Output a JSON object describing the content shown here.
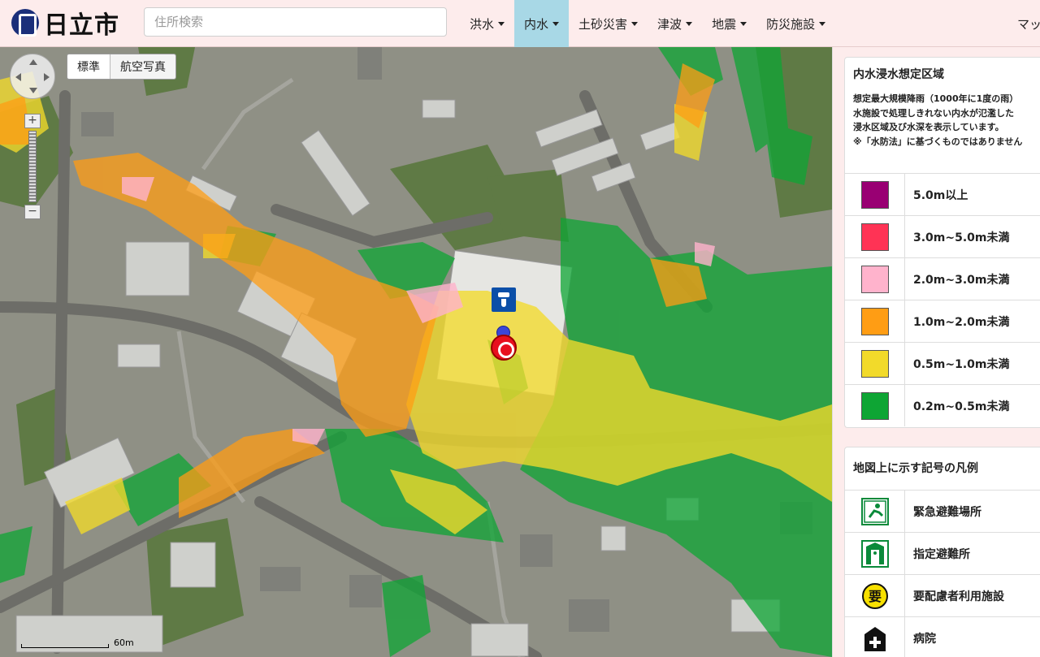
{
  "header": {
    "logo_text": "日立市",
    "search_placeholder": "住所検索",
    "nav": [
      {
        "label": "洪水",
        "active": false
      },
      {
        "label": "内水",
        "active": true
      },
      {
        "label": "土砂災害",
        "active": false
      },
      {
        "label": "津波",
        "active": false
      },
      {
        "label": "地震",
        "active": false
      },
      {
        "label": "防災施設",
        "active": false
      }
    ],
    "nav_right": "マップ"
  },
  "map": {
    "layers": {
      "standard": "標準",
      "aerial": "航空写真",
      "active": "standard"
    },
    "zoom_in": "+",
    "zoom_out": "−",
    "scale_label": "60m"
  },
  "legend": {
    "title": "内水浸水想定区域",
    "description": [
      "想定最大規模降雨（1000年に1度の雨）",
      "水施設で処理しきれない内水が氾濫した",
      "浸水区域及び水深を表示しています。",
      "※「水防法」に基づくものではありません"
    ],
    "items": [
      {
        "label": "5.0m以上",
        "color": "#990073"
      },
      {
        "label": "3.0m~5.0m未満",
        "color": "#ff3355"
      },
      {
        "label": "2.0m~3.0m未満",
        "color": "#ffb3cc"
      },
      {
        "label": "1.0m~2.0m未満",
        "color": "#ff9d14"
      },
      {
        "label": "0.5m~1.0m未満",
        "color": "#f2da2a"
      },
      {
        "label": "0.2m~0.5m未満",
        "color": "#0ea534"
      }
    ]
  },
  "symbols": {
    "title": "地図上に示す記号の凡例",
    "items": [
      {
        "label": "緊急避難場所",
        "icon": "emergency-evacuation-site-icon"
      },
      {
        "label": "指定避難所",
        "icon": "designated-shelter-icon"
      },
      {
        "label": "要配慮者利用施設",
        "icon": "care-facility-icon",
        "icon_text": "要"
      },
      {
        "label": "病院",
        "icon": "hospital-icon"
      }
    ]
  }
}
